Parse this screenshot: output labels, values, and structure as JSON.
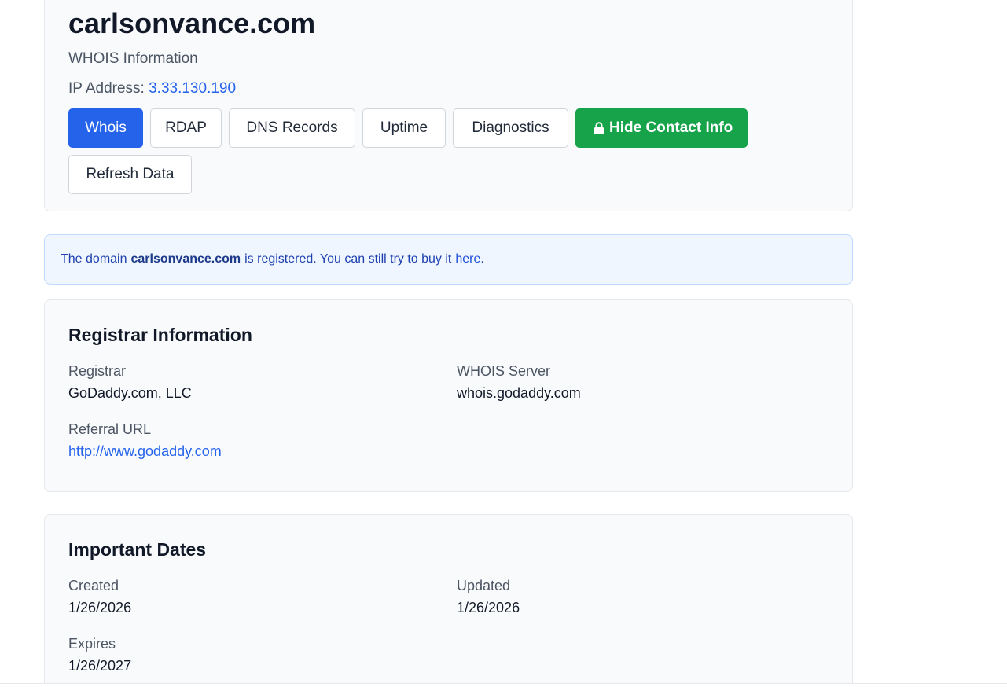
{
  "header": {
    "domain": "carlsonvance.com",
    "subtitle": "WHOIS Information",
    "ip_label": "IP Address:",
    "ip_value": "3.33.130.190"
  },
  "buttons": {
    "whois": "Whois",
    "rdap": "RDAP",
    "dns": "DNS Records",
    "uptime": "Uptime",
    "diagnostics": "Diagnostics",
    "hide_contact": "Hide Contact Info",
    "refresh": "Refresh Data"
  },
  "notice": {
    "prefix": "The domain",
    "domain": "carlsonvance.com",
    "middle": "is registered. You can still try to buy it",
    "link": "here",
    "suffix": "."
  },
  "registrar": {
    "title": "Registrar Information",
    "registrar_label": "Registrar",
    "registrar_value": "GoDaddy.com, LLC",
    "whois_server_label": "WHOIS Server",
    "whois_server_value": "whois.godaddy.com",
    "referral_label": "Referral URL",
    "referral_value": "http://www.godaddy.com"
  },
  "dates": {
    "title": "Important Dates",
    "created_label": "Created",
    "created_value": "1/26/2026",
    "updated_label": "Updated",
    "updated_value": "1/26/2026",
    "expires_label": "Expires",
    "expires_value": "1/26/2027"
  },
  "colors": {
    "primary": "#2563eb",
    "success": "#16a34a",
    "notice_bg": "#eff6ff",
    "card_bg": "#f8fafc"
  },
  "icons": {
    "lock": "lock-icon"
  }
}
